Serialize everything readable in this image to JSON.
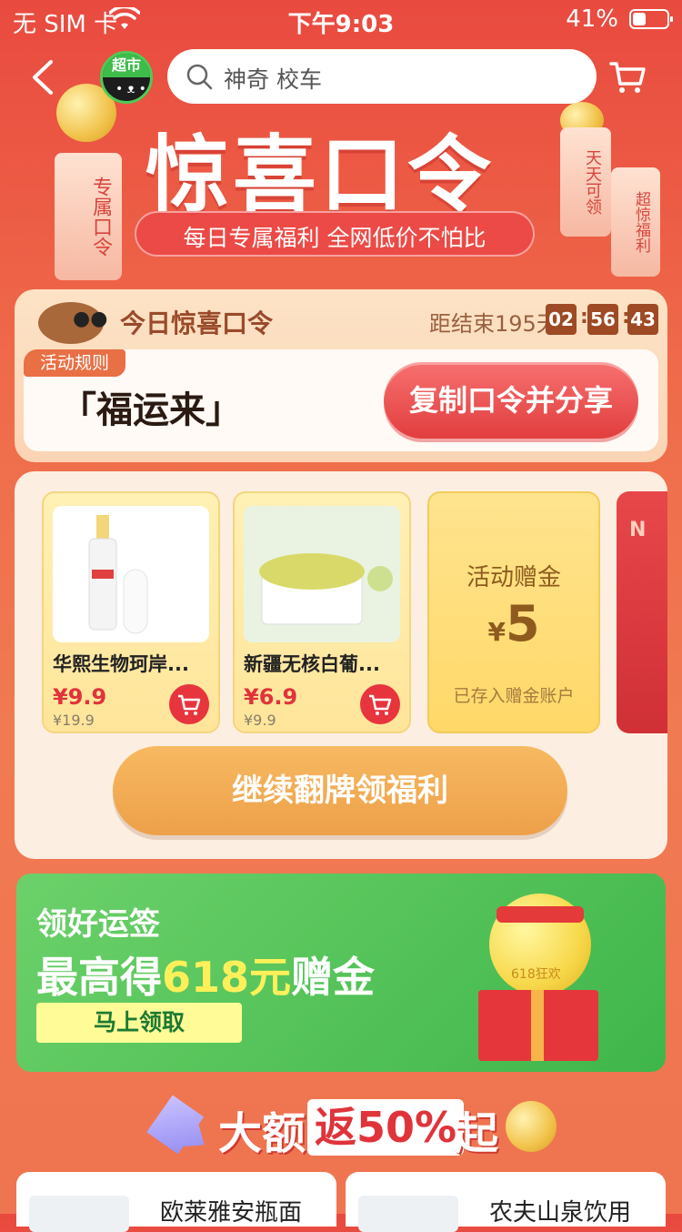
{
  "status_bar": {
    "carrier": "无 SIM 卡",
    "time": "下午9:03",
    "battery": "41%"
  },
  "header": {
    "badge_label": "超市",
    "search_placeholder": "神奇 校车"
  },
  "hero": {
    "title": "惊喜口令",
    "subtitle": "每日专属福利 全网低价不怕比",
    "tag_left": "专属口令",
    "tag_right_1": "天天可领",
    "tag_right_2": "超惊福利"
  },
  "slogan_card": {
    "label": "今日惊喜口令",
    "countdown_label": "距结束195天",
    "countdown": {
      "h": "02",
      "m": "56",
      "s": "43"
    },
    "rules": "活动规则",
    "slogan": "「福运来」",
    "copy_button": "复制口令并分享"
  },
  "products": [
    {
      "name": "华熙生物珂岸...",
      "price": "¥9.9",
      "original": "¥19.9"
    },
    {
      "name": "新疆无核白葡...",
      "price": "¥6.9",
      "original": "¥9.9"
    }
  ],
  "bonus": {
    "title": "活动赠金",
    "currency": "¥",
    "amount": "5",
    "note": "已存入赠金账户"
  },
  "flip_button": "继续翻牌领福利",
  "green_banner": {
    "line1": "领好运签",
    "line2_a": "最高得",
    "line2_hl": "618元",
    "line2_b": "赠金",
    "claim": "马上领取",
    "ball_label": "618狂欢"
  },
  "promo": {
    "part1": "大额",
    "part2": "返50%",
    "part3": "起"
  },
  "bottom": [
    {
      "title": "欧莱雅安瓶面"
    },
    {
      "title": "农夫山泉饮用"
    }
  ],
  "colors": {
    "brand_red": "#e94a3f",
    "price_red": "#e0333a",
    "green": "#3fb64a"
  }
}
